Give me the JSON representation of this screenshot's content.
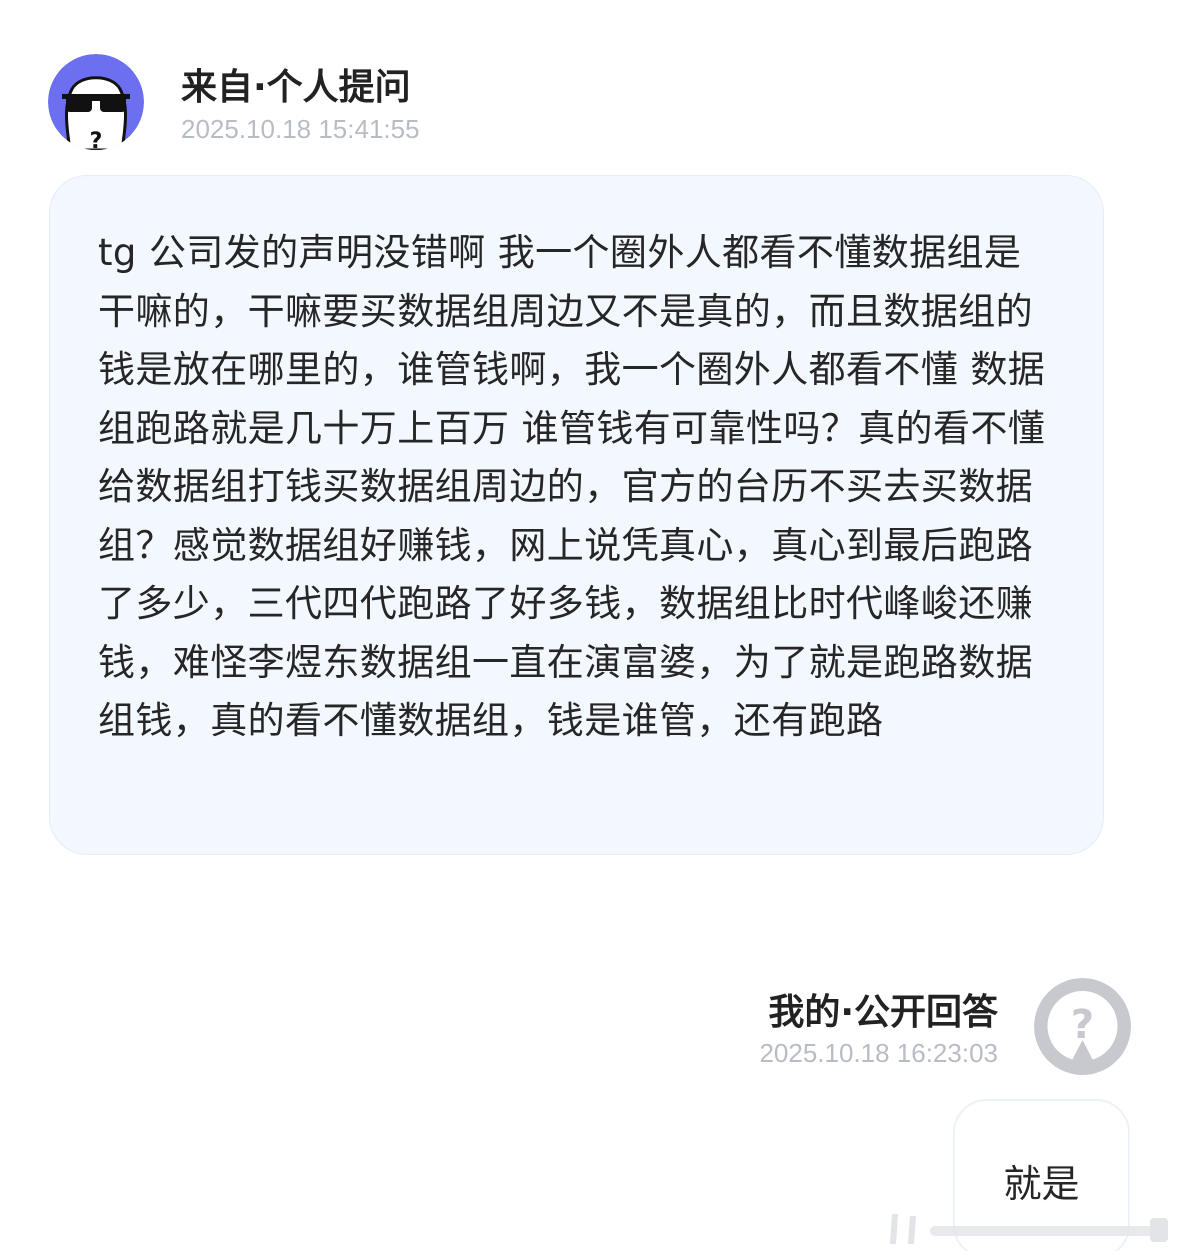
{
  "question": {
    "title": "来自·个人提问",
    "time": "2025.10.18 15:41:55",
    "text": "tg 公司发的声明没错啊 我一个圈外人都看不懂数据组是干嘛的，干嘛要买数据组周边又不是真的，而且数据组的钱是放在哪里的，谁管钱啊，我一个圈外人都看不懂 数据组跑路就是几十万上百万 谁管钱有可靠性吗？真的看不懂给数据组打钱买数据组周边的，官方的台历不买去买数据组？感觉数据组好赚钱，网上说凭真心，真心到最后跑路了多少，三代四代跑路了好多钱，数据组比时代峰峻还赚钱，难怪李煜东数据组一直在演富婆，为了就是跑路数据组钱，真的看不懂数据组，钱是谁管，还有跑路"
  },
  "answer": {
    "title": "我的·公开回答",
    "time": "2025.10.18 16:23:03",
    "text": "就是"
  },
  "icons": {
    "question_avatar": "sunglasses-face-avatar-icon",
    "answer_avatar": "question-mark-avatar-icon"
  },
  "colors": {
    "avatar_purple": "#6c6ff0",
    "bubble_bg": "#f3f7fe",
    "timestamp": "#b8bcc4",
    "answer_avatar_gray": "#c7c9cf"
  }
}
